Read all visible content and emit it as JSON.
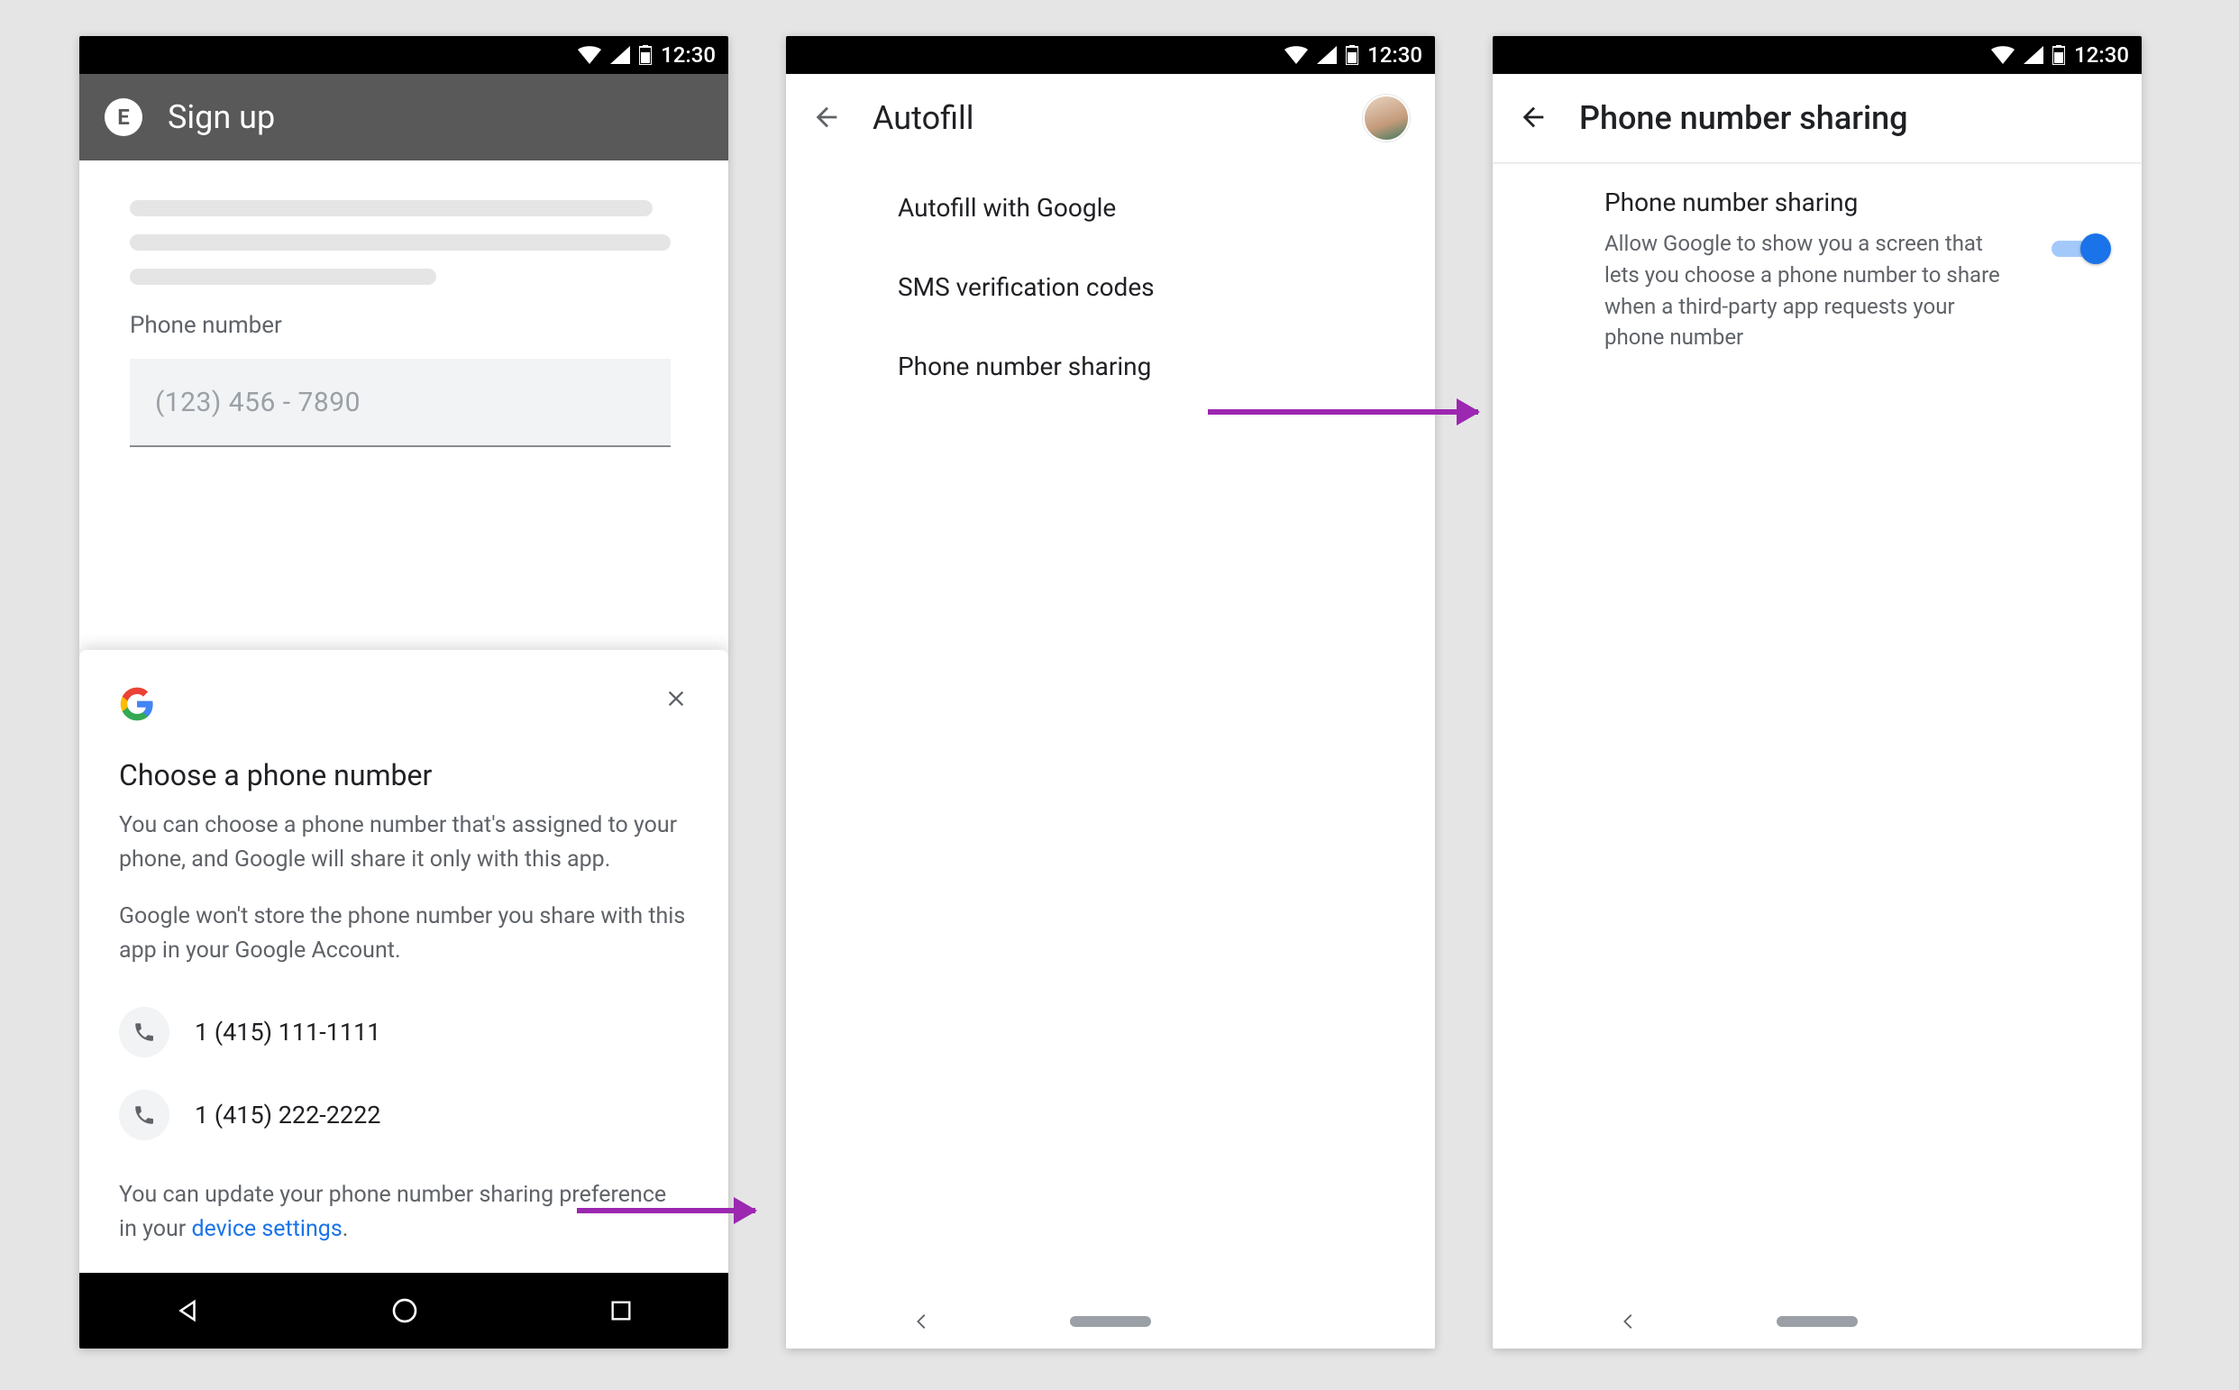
{
  "status_bar": {
    "time": "12:30"
  },
  "screen1": {
    "appbar": {
      "logo_letter": "E",
      "title": "Sign up"
    },
    "field_label": "Phone number",
    "phone_placeholder": "(123) 456 - 7890",
    "sheet": {
      "title": "Choose a phone number",
      "para1": "You can choose a phone number that's assigned to your phone, and Google will share it only with this app.",
      "para2": "Google won't store the phone number you share with this app in your Google Account.",
      "options": [
        {
          "number": "1 (415) 111-1111"
        },
        {
          "number": "1 (415) 222-2222"
        }
      ],
      "footnote_prefix": "You can update your phone number sharing preference in your ",
      "footnote_link": "device settings",
      "footnote_suffix": "."
    }
  },
  "screen2": {
    "title": "Autofill",
    "items": [
      {
        "label": "Autofill with Google"
      },
      {
        "label": "SMS verification codes"
      },
      {
        "label": "Phone number sharing"
      }
    ]
  },
  "screen3": {
    "title": "Phone number sharing",
    "setting_title": "Phone number sharing",
    "setting_sub": "Allow Google to show you a screen that lets you choose a phone number to share when a third-party app requests your phone number",
    "switch_on": true
  },
  "colors": {
    "accent": "#1a73e8",
    "arrow": "#9c27b0"
  }
}
